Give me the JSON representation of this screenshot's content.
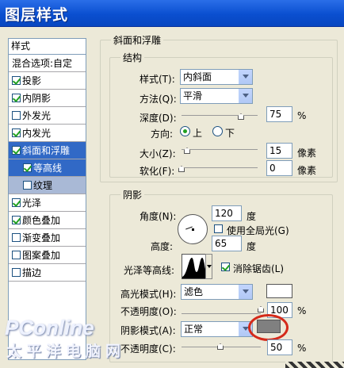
{
  "title": "图层样式",
  "sidebar": {
    "header": "样式",
    "items": [
      {
        "label": "混合选项:自定",
        "checkbox": false
      },
      {
        "label": "投影",
        "checkbox": true,
        "checked": true
      },
      {
        "label": "内阴影",
        "checkbox": true,
        "checked": true
      },
      {
        "label": "外发光",
        "checkbox": true,
        "checked": false
      },
      {
        "label": "内发光",
        "checkbox": true,
        "checked": true
      },
      {
        "label": "斜面和浮雕",
        "checkbox": true,
        "checked": true,
        "selected": true
      },
      {
        "label": "等高线",
        "checkbox": true,
        "checked": true,
        "sub": true
      },
      {
        "label": "纹理",
        "checkbox": true,
        "checked": false,
        "sub": true
      },
      {
        "label": "光泽",
        "checkbox": true,
        "checked": true
      },
      {
        "label": "颜色叠加",
        "checkbox": true,
        "checked": true
      },
      {
        "label": "渐变叠加",
        "checkbox": true,
        "checked": false
      },
      {
        "label": "图案叠加",
        "checkbox": true,
        "checked": false
      },
      {
        "label": "描边",
        "checkbox": true,
        "checked": false
      }
    ]
  },
  "bevel": {
    "group_title": "斜面和浮雕",
    "structure_title": "结构",
    "style_label": "样式(T):",
    "style_value": "内斜面",
    "technique_label": "方法(Q):",
    "technique_value": "平滑",
    "depth_label": "深度(D):",
    "depth_value": "75",
    "depth_unit": "%",
    "direction_label": "方向:",
    "dir_up": "上",
    "dir_down": "下",
    "size_label": "大小(Z):",
    "size_value": "15",
    "size_unit": "像素",
    "soften_label": "软化(F):",
    "soften_value": "0",
    "soften_unit": "像素"
  },
  "shading": {
    "title": "阴影",
    "angle_label": "角度(N):",
    "angle_value": "120",
    "angle_unit": "度",
    "global_light_label": "使用全局光(G)",
    "altitude_label": "高度:",
    "altitude_value": "65",
    "altitude_unit": "度",
    "gloss_label": "光泽等高线:",
    "antialias_label": "消除锯齿(L)",
    "highlight_mode_label": "高光模式(H):",
    "highlight_mode_value": "滤色",
    "highlight_opacity_label": "不透明度(O):",
    "highlight_opacity_value": "100",
    "highlight_opacity_unit": "%",
    "shadow_mode_label": "阴影模式(A):",
    "shadow_mode_value": "正常",
    "shadow_opacity_label": "不透明度(C):",
    "shadow_opacity_value": "50",
    "shadow_opacity_unit": "%",
    "highlight_color": "#ffffff",
    "shadow_color": "#808080"
  },
  "watermark": {
    "line1": "PConline",
    "line2": "太平洋电脑网"
  }
}
